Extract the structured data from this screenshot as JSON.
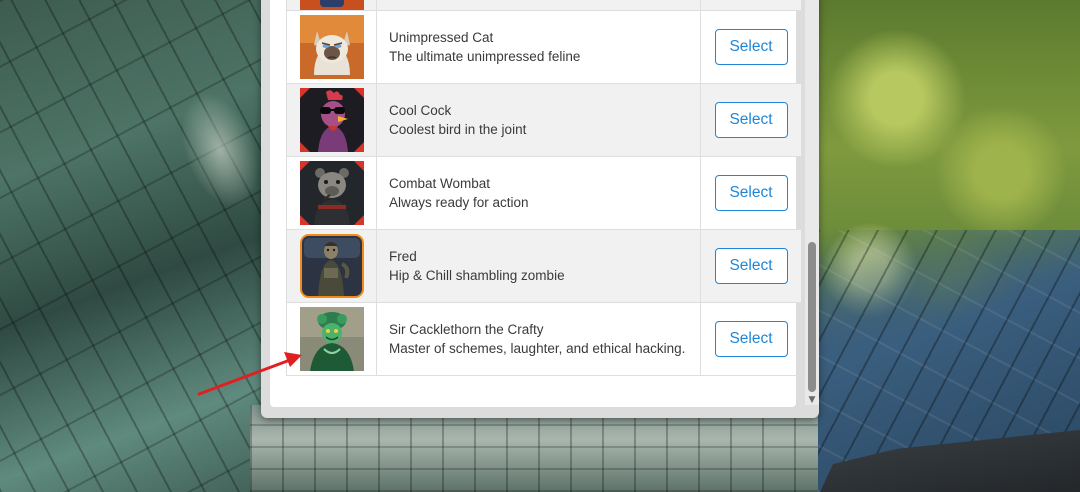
{
  "characters": [
    {
      "name": "Unimpressed Cat",
      "description": "The ultimate unimpressed feline",
      "select_label": "Select",
      "avatar_icon": "unimpressed-cat-avatar"
    },
    {
      "name": "Cool Cock",
      "description": "Coolest bird in the joint",
      "select_label": "Select",
      "avatar_icon": "cool-cock-avatar"
    },
    {
      "name": "Combat Wombat",
      "description": "Always ready for action",
      "select_label": "Select",
      "avatar_icon": "combat-wombat-avatar"
    },
    {
      "name": "Fred",
      "description": "Hip & Chill shambling zombie",
      "select_label": "Select",
      "avatar_icon": "fred-zombie-avatar"
    },
    {
      "name": "Sir Cacklethorn the Crafty",
      "description": "Master of schemes, laughter, and ethical hacking.",
      "select_label": "Select",
      "avatar_icon": "sir-cacklethorn-avatar"
    }
  ],
  "colors": {
    "accent": "#1f86d6",
    "annotation_arrow": "#e02020",
    "row_alt": "#f1f1f1"
  },
  "icons": {
    "scroll_down": "▼",
    "annotation": "red-arrow-icon"
  }
}
